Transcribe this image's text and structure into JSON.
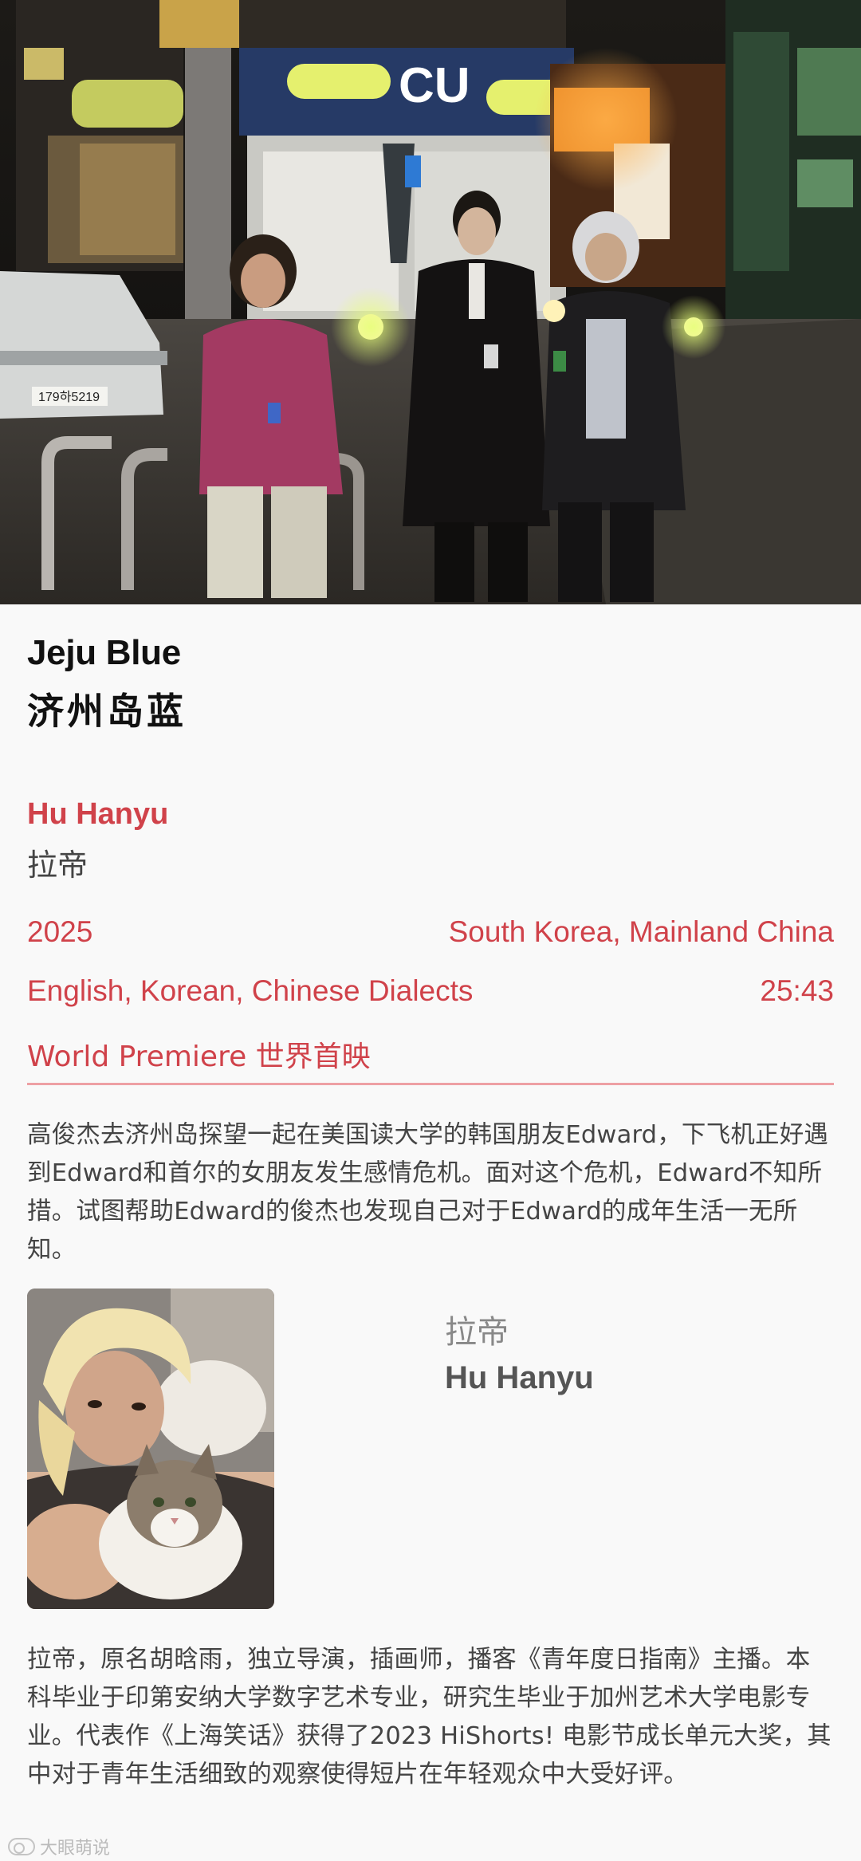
{
  "hero": {
    "image": "night street photo: three young men standing in front of a neon convenience store",
    "store_sign": "CU",
    "license_plate": "179하5219"
  },
  "film": {
    "title_en": "Jeju Blue",
    "title_cn": "济州岛蓝",
    "director_en": "Hu Hanyu",
    "director_cn": "拉帝",
    "year": "2025",
    "countries": "South Korea, Mainland China",
    "languages": "English, Korean, Chinese Dialects",
    "runtime": "25:43",
    "premiere": "World Premiere 世界首映"
  },
  "synopsis": "高俊杰去济州岛探望一起在美国读大学的韩国朋友Edward，下飞机正好遇到Edward和首尔的女朋友发生感情危机。面对这个危机，Edward不知所措。试图帮助Edward的俊杰也发现自己对于Edward的成年生活一无所知。",
  "person": {
    "name_cn": "拉帝",
    "name_en": "Hu Hanyu",
    "portrait": "photo of director with bleached hair holding a tabby cat"
  },
  "bio": "拉帝，原名胡晗雨，独立导演，插画师，播客《青年度日指南》主播。本科毕业于印第安纳大学数字艺术专业，研究生毕业于加州艺术大学电影专业。代表作《上海笑话》获得了2023 HiShorts! 电影节成长单元大奖，其中对于青年生活细致的观察使得短片在年轻观众中大受好评。",
  "watermark": {
    "text": "大眼萌说",
    "icon": "app-logo-icon"
  },
  "colors": {
    "accent": "#d0424a",
    "divider": "#eea0a4",
    "body_text": "#444444",
    "background": "#f9f9f9"
  }
}
